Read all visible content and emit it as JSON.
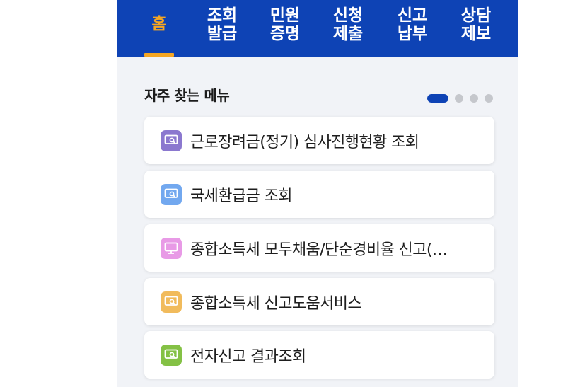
{
  "nav": {
    "tabs": [
      {
        "label": "홈",
        "active": true
      },
      {
        "label": "조회\n발급",
        "active": false
      },
      {
        "label": "민원\n증명",
        "active": false
      },
      {
        "label": "신청\n제출",
        "active": false
      },
      {
        "label": "신고\n납부",
        "active": false
      },
      {
        "label": "상담\n제보",
        "active": false
      }
    ]
  },
  "frequent_menu": {
    "title": "자주 찾는 메뉴",
    "pager": {
      "page_count": 4,
      "current_page": 1
    },
    "items": [
      {
        "label": "근로장려금(정기) 심사진행현황 조회",
        "icon": "search-screen-icon",
        "icon_color": "#8b78cf"
      },
      {
        "label": "국세환급금 조회",
        "icon": "search-screen-icon",
        "icon_color": "#72a8ef"
      },
      {
        "label": "종합소득세 모두채움/단순경비율 신고(…",
        "icon": "monitor-icon",
        "icon_color": "#e89ae6"
      },
      {
        "label": "종합소득세 신고도움서비스",
        "icon": "search-screen-icon",
        "icon_color": "#f1bb5c"
      },
      {
        "label": "전자신고 결과조회",
        "icon": "search-screen-icon",
        "icon_color": "#84c145"
      }
    ]
  },
  "colors": {
    "brand_blue": "#0e43b5",
    "active_orange": "#f5a623",
    "background": "#f1f3f7"
  }
}
